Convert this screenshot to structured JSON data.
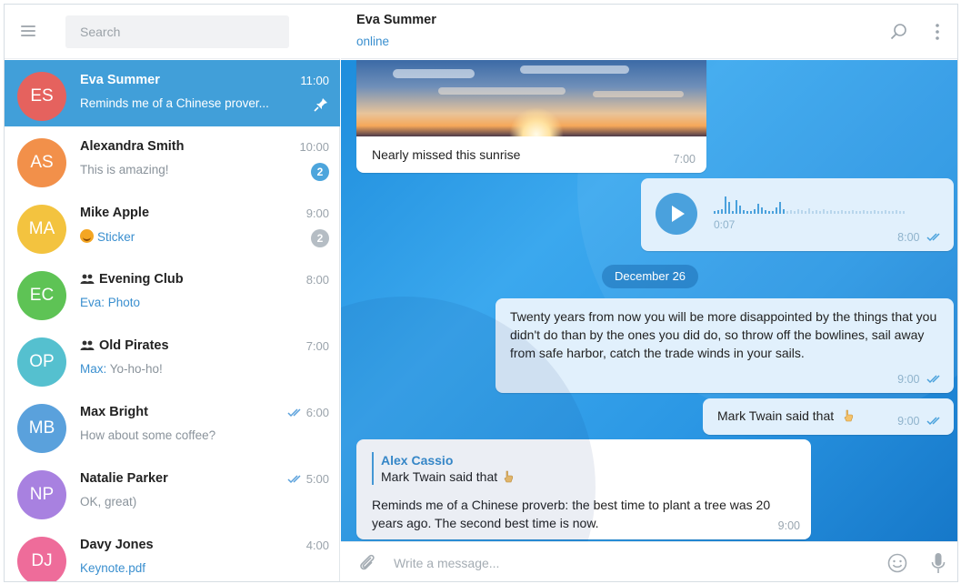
{
  "search": {
    "placeholder": "Search"
  },
  "chats": [
    {
      "initials": "ES",
      "name": "Eva Summer",
      "time": "11:00",
      "preview": "Reminds me of a Chinese prover...",
      "avatar_color": "#e5625e",
      "pinned": true
    },
    {
      "initials": "AS",
      "name": "Alexandra Smith",
      "time": "10:00",
      "preview": "This is amazing!",
      "avatar_color": "#f2904a",
      "unread": "2"
    },
    {
      "initials": "MA",
      "name": "Mike Apple",
      "time": "9:00",
      "preview": "Sticker",
      "avatar_color": "#f3c33f",
      "unread_muted": "2"
    },
    {
      "initials": "EC",
      "name": "Evening Club",
      "time": "8:00",
      "preview_sender": "Eva: ",
      "preview": "Photo",
      "avatar_color": "#5ec355",
      "group": true
    },
    {
      "initials": "OP",
      "name": "Old Pirates",
      "time": "7:00",
      "preview_sender": "Max: ",
      "preview": "Yo-ho-ho!",
      "avatar_color": "#55c0cf",
      "group": true
    },
    {
      "initials": "MB",
      "name": "Max Bright",
      "time": "6:00",
      "preview": "How about some coffee?",
      "avatar_color": "#5aa1dc",
      "read": true
    },
    {
      "initials": "NP",
      "name": "Natalie Parker",
      "time": "5:00",
      "preview": "OK, great)",
      "avatar_color": "#a881e0",
      "read": true
    },
    {
      "initials": "DJ",
      "name": "Davy Jones",
      "time": "4:00",
      "preview": "Keynote.pdf",
      "avatar_color": "#ee6c9a"
    }
  ],
  "header": {
    "name": "Eva Summer",
    "status": "online"
  },
  "messages": {
    "photo": {
      "caption": "Nearly missed this sunrise",
      "time": "7:00"
    },
    "voice": {
      "duration": "0:07",
      "time": "8:00"
    },
    "date_badge": "December 26",
    "quote": {
      "text": "Twenty years from now you will be more disappointed by the things that you didn't do than by the ones you did do, so throw off the bowlines, sail away from safe harbor, catch the trade winds in your sails.",
      "time": "9:00"
    },
    "twain": {
      "text": "Mark Twain said that",
      "time": "9:00"
    },
    "reply": {
      "author": "Alex Cassio",
      "quoted": "Mark Twain said that",
      "text": "Reminds me of a Chinese proverb: the best time to plant a tree was 20 years ago. The second best time is now.",
      "time": "9:00"
    }
  },
  "composer": {
    "placeholder": "Write a message..."
  },
  "colors": {
    "accent": "#419fd9",
    "link": "#3a8fcf",
    "outgoing_bubble": "#e1f0fc"
  }
}
